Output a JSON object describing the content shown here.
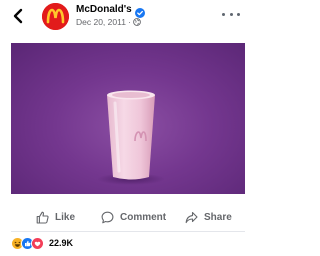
{
  "post": {
    "page_name": "McDonald's",
    "date": "Dec 20, 2011",
    "separator": "·",
    "privacy_icon": "globe-icon",
    "verified_icon": "verified-badge-icon"
  },
  "media": {
    "subject": "pink milkshake cup on purple background"
  },
  "actions": {
    "like": "Like",
    "comment": "Comment",
    "share": "Share"
  },
  "reactions": {
    "icons": [
      "haha-icon",
      "like-icon",
      "love-icon"
    ],
    "count": "22.9K"
  },
  "colors": {
    "brand_red": "#e21b1b",
    "brand_yellow": "#ffc72c",
    "verified_blue": "#1877f2",
    "secondary_text": "#65676b",
    "media_purple": "#74378f"
  }
}
